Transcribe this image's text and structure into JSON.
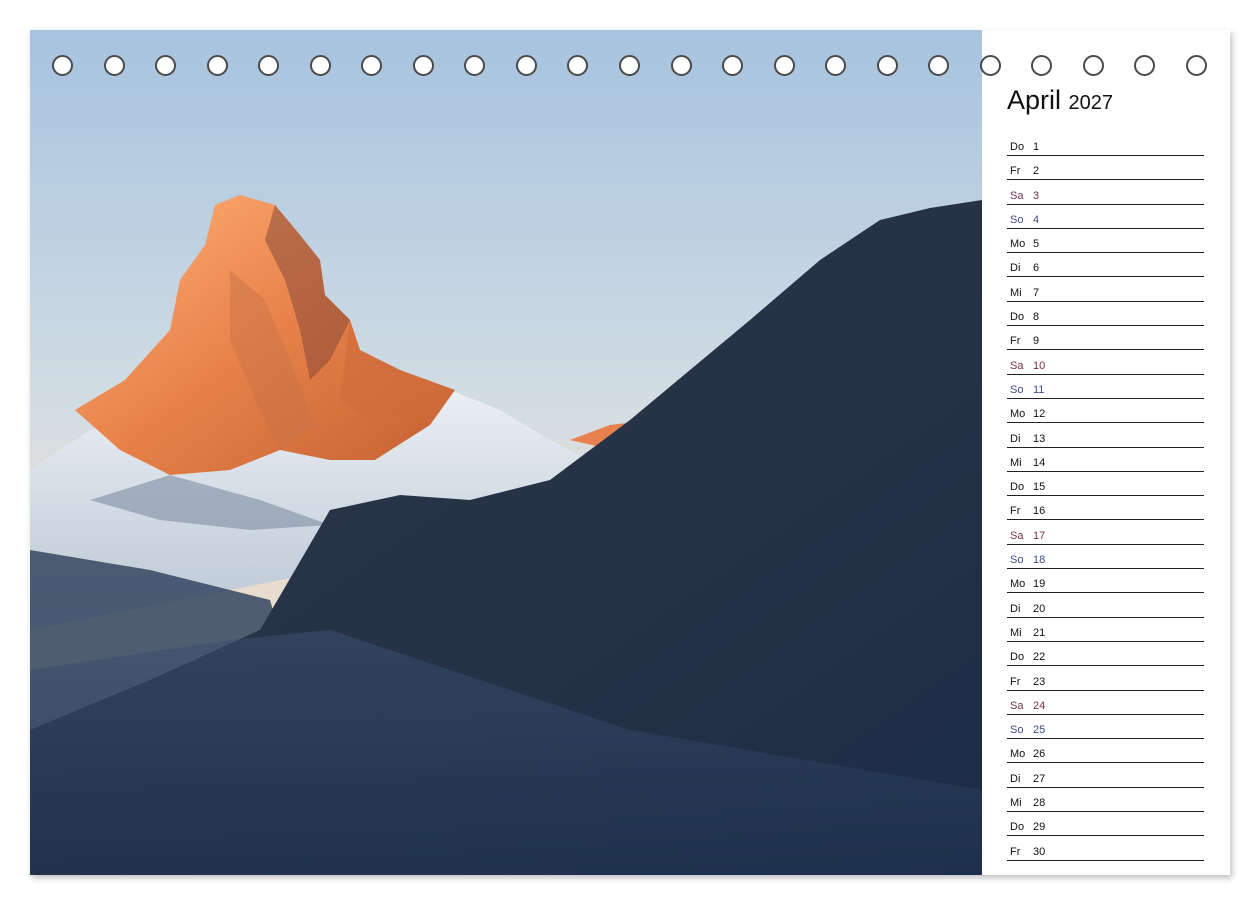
{
  "calendar": {
    "month": "April",
    "year": "2027",
    "days": [
      {
        "wd": "Do",
        "num": "1",
        "type": "weekday"
      },
      {
        "wd": "Fr",
        "num": "2",
        "type": "weekday"
      },
      {
        "wd": "Sa",
        "num": "3",
        "type": "sat"
      },
      {
        "wd": "So",
        "num": "4",
        "type": "sun"
      },
      {
        "wd": "Mo",
        "num": "5",
        "type": "weekday"
      },
      {
        "wd": "Di",
        "num": "6",
        "type": "weekday"
      },
      {
        "wd": "Mi",
        "num": "7",
        "type": "weekday"
      },
      {
        "wd": "Do",
        "num": "8",
        "type": "weekday"
      },
      {
        "wd": "Fr",
        "num": "9",
        "type": "weekday"
      },
      {
        "wd": "Sa",
        "num": "10",
        "type": "sat"
      },
      {
        "wd": "So",
        "num": "11",
        "type": "sun"
      },
      {
        "wd": "Mo",
        "num": "12",
        "type": "weekday"
      },
      {
        "wd": "Di",
        "num": "13",
        "type": "weekday"
      },
      {
        "wd": "Mi",
        "num": "14",
        "type": "weekday"
      },
      {
        "wd": "Do",
        "num": "15",
        "type": "weekday"
      },
      {
        "wd": "Fr",
        "num": "16",
        "type": "weekday"
      },
      {
        "wd": "Sa",
        "num": "17",
        "type": "sat"
      },
      {
        "wd": "So",
        "num": "18",
        "type": "sun"
      },
      {
        "wd": "Mo",
        "num": "19",
        "type": "weekday"
      },
      {
        "wd": "Di",
        "num": "20",
        "type": "weekday"
      },
      {
        "wd": "Mi",
        "num": "21",
        "type": "weekday"
      },
      {
        "wd": "Do",
        "num": "22",
        "type": "weekday"
      },
      {
        "wd": "Fr",
        "num": "23",
        "type": "weekday"
      },
      {
        "wd": "Sa",
        "num": "24",
        "type": "sat"
      },
      {
        "wd": "So",
        "num": "25",
        "type": "sun"
      },
      {
        "wd": "Mo",
        "num": "26",
        "type": "weekday"
      },
      {
        "wd": "Di",
        "num": "27",
        "type": "weekday"
      },
      {
        "wd": "Mi",
        "num": "28",
        "type": "weekday"
      },
      {
        "wd": "Do",
        "num": "29",
        "type": "weekday"
      },
      {
        "wd": "Fr",
        "num": "30",
        "type": "weekday"
      }
    ]
  },
  "binding": {
    "ring_count": 23
  },
  "colors": {
    "saturday": "#7a2f4f",
    "sunday": "#3f4a8a",
    "sky_top": "#a9c4e0",
    "alpenglow": "#f08a4a",
    "mountain_dark": "#1f2f48"
  },
  "photo": {
    "subject": "mountain-peak-alpenglow"
  }
}
